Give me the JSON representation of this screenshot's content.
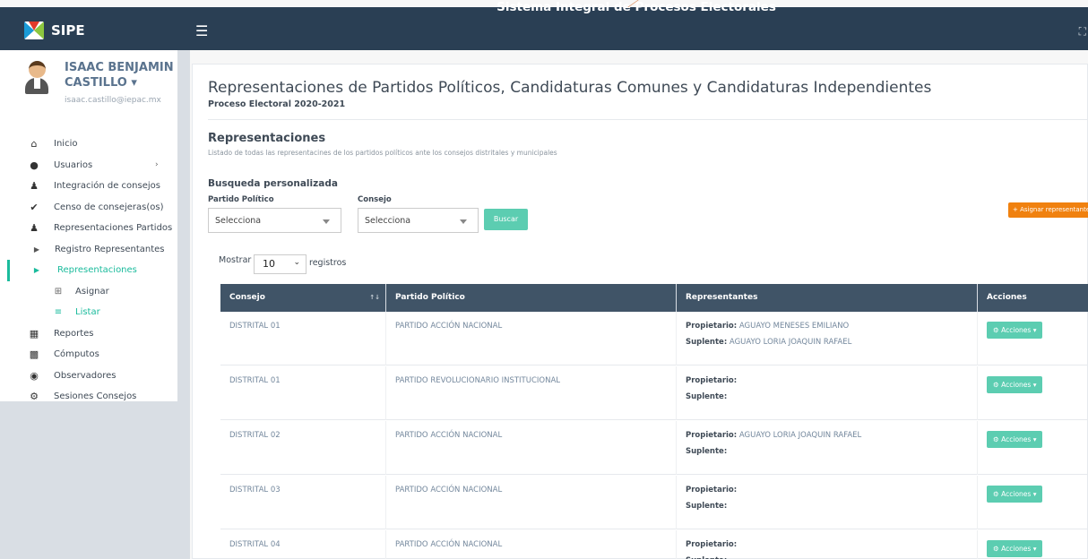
{
  "app": {
    "brand": "SIPE",
    "title": "Sistema Integral de Procesos Electorales"
  },
  "user": {
    "name": "ISAAC BENJAMIN CASTILLO",
    "email": "isaac.castillo@iepac.mx"
  },
  "nav": [
    {
      "label": "Inicio",
      "icon": "home-icon"
    },
    {
      "label": "Usuarios",
      "icon": "users-icon"
    },
    {
      "label": "Integración de consejos",
      "icon": "group-icon"
    },
    {
      "label": "Censo de consejeras(os)",
      "icon": "check-icon"
    },
    {
      "label": "Representaciones Partidos",
      "icon": "people-icon"
    },
    {
      "label": "Registro Representantes",
      "icon": "play-icon"
    },
    {
      "label": "Representaciones",
      "icon": "play-icon"
    },
    {
      "label": "Asignar",
      "icon": "plus-square-icon"
    },
    {
      "label": "Listar",
      "icon": "list-icon"
    },
    {
      "label": "Reportes",
      "icon": "report-icon"
    },
    {
      "label": "Cómputos",
      "icon": "bar-chart-icon"
    },
    {
      "label": "Observadores",
      "icon": "eye-icon"
    },
    {
      "label": "Sesiones Consejos",
      "icon": "gear-icon"
    }
  ],
  "page": {
    "title": "Representaciones de Partidos Políticos, Candidaturas Comunes y Candidaturas Independientes",
    "subtitle": "Proceso Electoral 2020-2021",
    "section_title": "Representaciones",
    "section_desc": "Listado de todas las representacines de los partidos políticos ante los consejos distritales y municipales",
    "search_title": "Busqueda personalizada",
    "assign_button": "+ Asignar representante",
    "filters": {
      "partido_label": "Partido Político",
      "partido_value": "Selecciona",
      "consejo_label": "Consejo",
      "consejo_value": "Selecciona",
      "buscar": "Buscar"
    },
    "length": {
      "prefix": "Mostrar",
      "value": "10",
      "suffix": "registros"
    }
  },
  "table": {
    "headers": [
      "Consejo",
      "Partido Político",
      "Representantes",
      "Acciones"
    ],
    "sort_glyph": "↑↓",
    "propietario_label": "Propietario:",
    "suplente_label": "Suplente:",
    "action_label": "Acciones",
    "rows": [
      {
        "consejo": "DISTRITAL 01",
        "partido": "PARTIDO ACCIÓN NACIONAL",
        "propietario": "AGUAYO MENESES EMILIANO",
        "suplente": "AGUAYO LORIA JOAQUIN RAFAEL"
      },
      {
        "consejo": "DISTRITAL 01",
        "partido": "PARTIDO REVOLUCIONARIO INSTITUCIONAL",
        "propietario": "",
        "suplente": ""
      },
      {
        "consejo": "DISTRITAL 02",
        "partido": "PARTIDO ACCIÓN NACIONAL",
        "propietario": "AGUAYO LORIA JOAQUIN RAFAEL",
        "suplente": ""
      },
      {
        "consejo": "DISTRITAL 03",
        "partido": "PARTIDO ACCIÓN NACIONAL",
        "propietario": "",
        "suplente": ""
      },
      {
        "consejo": "DISTRITAL 04",
        "partido": "PARTIDO ACCIÓN NACIONAL",
        "propietario": "",
        "suplente": ""
      }
    ]
  },
  "colors": {
    "topbar": "#2a3f54",
    "accent": "#1abb9c",
    "orange": "#f0810f",
    "table_header": "#405467"
  }
}
